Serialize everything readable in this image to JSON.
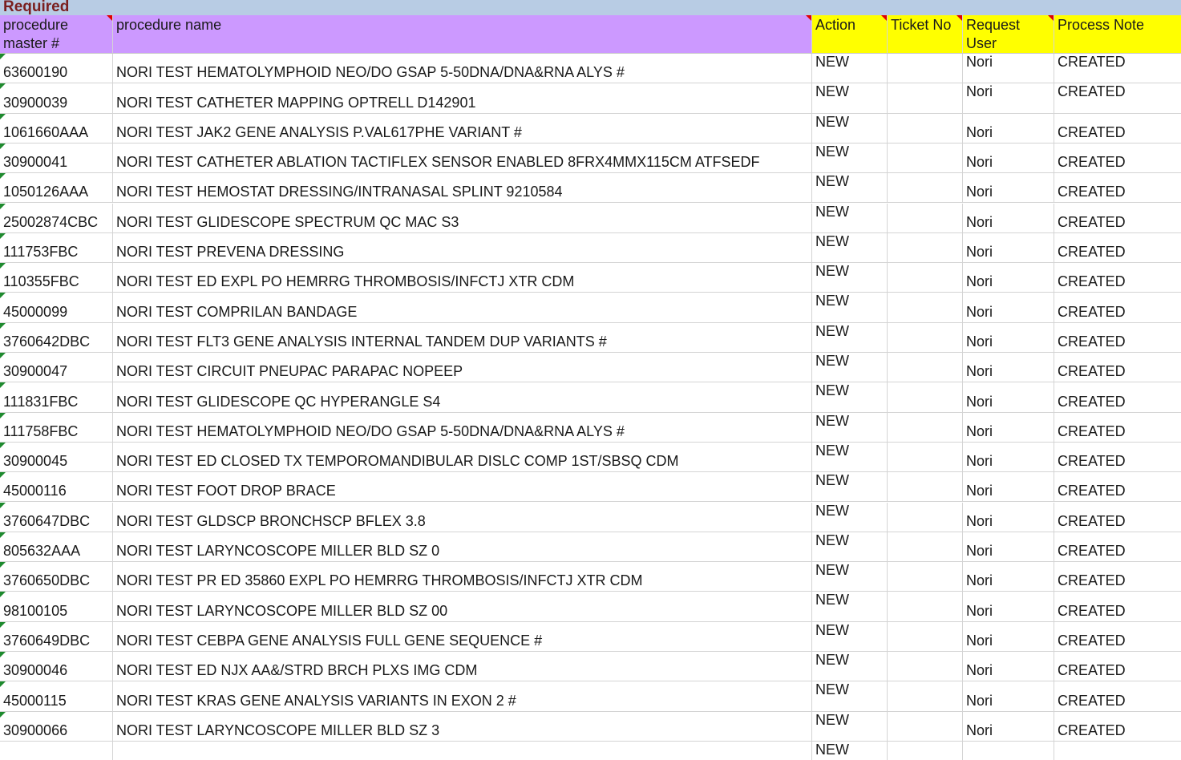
{
  "banner": {
    "label": "Required"
  },
  "headers": [
    {
      "key": "master",
      "label": "procedure master #"
    },
    {
      "key": "name",
      "label": "procedure name"
    },
    {
      "key": "action",
      "label": "Action"
    },
    {
      "key": "ticket",
      "label": "Ticket No"
    },
    {
      "key": "user",
      "label": "Request User"
    },
    {
      "key": "note",
      "label": "Process  Note"
    }
  ],
  "colors": {
    "required_band": "#b8cce4",
    "required_text": "#7a1f1f",
    "header_purple": "#cc99ff",
    "header_yellow": "#ffff00",
    "comment_marker": "#e00000",
    "error_marker": "#1e8a2e"
  },
  "rows": [
    {
      "master": "63600190",
      "name": "NORI TEST  HEMATOLYMPHOID NEO/DO GSAP 5-50DNA/DNA&RNA ALYS #",
      "action": "NEW",
      "ticket": "",
      "user": "Nori",
      "note": "CREATED"
    },
    {
      "master": "30900039",
      "name": "NORI TEST  CATHETER MAPPING OPTRELL D142901",
      "action": "NEW",
      "ticket": "",
      "user": "Nori",
      "note": "CREATED"
    },
    {
      "master": "1061660AAA",
      "name": "NORI TEST  JAK2 GENE ANALYSIS P.VAL617PHE VARIANT #",
      "action": "NEW",
      "ticket": "",
      "user": "Nori",
      "note": "CREATED"
    },
    {
      "master": "30900041",
      "name": "NORI TEST  CATHETER ABLATION TACTIFLEX SENSOR ENABLED 8FRX4MMX115CM ATFSEDF",
      "action": "NEW",
      "ticket": "",
      "user": "Nori",
      "note": "CREATED"
    },
    {
      "master": "1050126AAA",
      "name": "NORI TEST  HEMOSTAT DRESSING/INTRANASAL SPLINT 9210584",
      "action": "NEW",
      "ticket": "",
      "user": "Nori",
      "note": "CREATED"
    },
    {
      "master": "25002874CBC",
      "name": "NORI TEST  GLIDESCOPE SPECTRUM QC MAC S3",
      "action": "NEW",
      "ticket": "",
      "user": "Nori",
      "note": "CREATED"
    },
    {
      "master": "111753FBC",
      "name": "NORI TEST  PREVENA DRESSING",
      "action": "NEW",
      "ticket": "",
      "user": "Nori",
      "note": "CREATED"
    },
    {
      "master": "110355FBC",
      "name": "NORI TEST  ED EXPL PO HEMRRG THROMBOSIS/INFCTJ XTR CDM",
      "action": "NEW",
      "ticket": "",
      "user": "Nori",
      "note": "CREATED"
    },
    {
      "master": "45000099",
      "name": "NORI TEST  COMPRILAN BANDAGE",
      "action": "NEW",
      "ticket": "",
      "user": "Nori",
      "note": "CREATED"
    },
    {
      "master": "3760642DBC",
      "name": "NORI TEST  FLT3 GENE ANALYSIS INTERNAL TANDEM DUP VARIANTS #",
      "action": "NEW",
      "ticket": "",
      "user": "Nori",
      "note": "CREATED"
    },
    {
      "master": "30900047",
      "name": "NORI TEST  CIRCUIT PNEUPAC PARAPAC NOPEEP",
      "action": "NEW",
      "ticket": "",
      "user": "Nori",
      "note": "CREATED"
    },
    {
      "master": "111831FBC",
      "name": "NORI TEST  GLIDESCOPE QC HYPERANGLE S4",
      "action": "NEW",
      "ticket": "",
      "user": "Nori",
      "note": "CREATED"
    },
    {
      "master": "111758FBC",
      "name": "NORI TEST  HEMATOLYMPHOID NEO/DO GSAP 5-50DNA/DNA&RNA ALYS #",
      "action": "NEW",
      "ticket": "",
      "user": "Nori",
      "note": "CREATED"
    },
    {
      "master": "30900045",
      "name": "NORI TEST  ED CLOSED TX TEMPOROMANDIBULAR DISLC COMP 1ST/SBSQ CDM",
      "action": "NEW",
      "ticket": "",
      "user": "Nori",
      "note": "CREATED"
    },
    {
      "master": "45000116",
      "name": "NORI TEST  FOOT DROP BRACE",
      "action": "NEW",
      "ticket": "",
      "user": "Nori",
      "note": "CREATED"
    },
    {
      "master": "3760647DBC",
      "name": "NORI TEST  GLDSCP BRONCHSCP BFLEX 3.8",
      "action": "NEW",
      "ticket": "",
      "user": "Nori",
      "note": "CREATED"
    },
    {
      "master": "805632AAA",
      "name": "NORI TEST  LARYNCOSCOPE MILLER BLD SZ 0",
      "action": "NEW",
      "ticket": "",
      "user": "Nori",
      "note": "CREATED"
    },
    {
      "master": "3760650DBC",
      "name": "NORI TEST  PR ED 35860 EXPL PO HEMRRG THROMBOSIS/INFCTJ XTR CDM",
      "action": "NEW",
      "ticket": "",
      "user": "Nori",
      "note": "CREATED"
    },
    {
      "master": "98100105",
      "name": "NORI TEST  LARYNCOSCOPE MILLER BLD SZ 00",
      "action": "NEW",
      "ticket": "",
      "user": "Nori",
      "note": "CREATED"
    },
    {
      "master": "3760649DBC",
      "name": "NORI TEST  CEBPA GENE ANALYSIS FULL GENE SEQUENCE #",
      "action": "NEW",
      "ticket": "",
      "user": "Nori",
      "note": "CREATED"
    },
    {
      "master": "30900046",
      "name": "NORI TEST  ED NJX AA&/STRD BRCH PLXS IMG CDM",
      "action": "NEW",
      "ticket": "",
      "user": "Nori",
      "note": "CREATED"
    },
    {
      "master": "45000115",
      "name": "NORI TEST  KRAS GENE ANALYSIS VARIANTS IN EXON 2 #",
      "action": "NEW",
      "ticket": "",
      "user": "Nori",
      "note": "CREATED"
    },
    {
      "master": "30900066",
      "name": "NORI TEST  LARYNCOSCOPE MILLER BLD SZ 3",
      "action": "NEW",
      "ticket": "",
      "user": "Nori",
      "note": "CREATED"
    },
    {
      "master": "",
      "name": "",
      "action": "NEW",
      "ticket": "",
      "user": "",
      "note": ""
    }
  ]
}
